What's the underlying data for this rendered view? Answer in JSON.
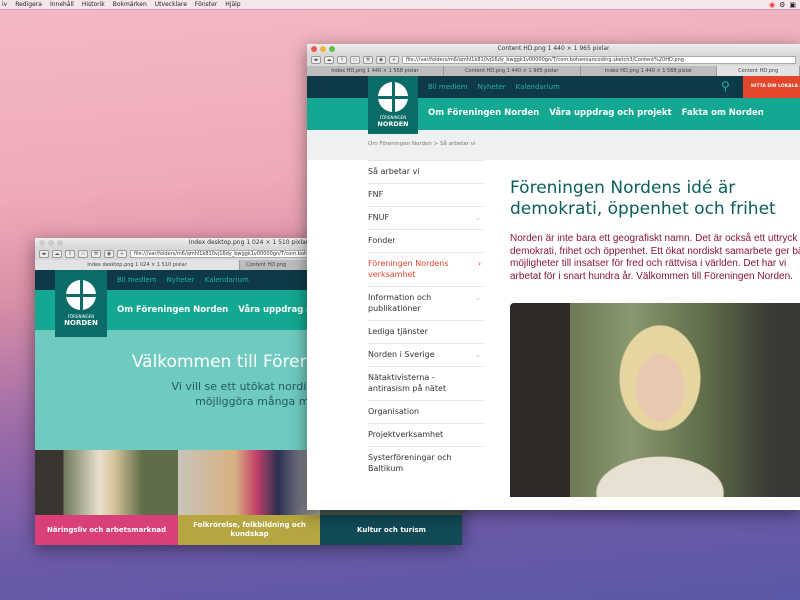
{
  "menubar": {
    "items": [
      "iv",
      "Redigera",
      "Innehåll",
      "Historik",
      "Bokmärken",
      "Utvecklare",
      "Fönster",
      "Hjälp"
    ]
  },
  "back_window": {
    "title": "Index desktop.png 1 024 × 1 510 pixlar",
    "url": "file:///var/folders/m6/qmhl1k810vj16dy_bwggk1v00000gn/T/com.bohemiancoding.sketch3/Index%20desktop.png",
    "tabs": [
      "Index desktop.png 1 024 × 1 510 pixlar",
      "Content HD.png"
    ],
    "logo": {
      "line1": "FÖRENINGEN",
      "line2": "NORDEN"
    },
    "top_links": [
      "Bli medlem",
      "Nyheter",
      "Kalendarium"
    ],
    "nav": [
      "Om Föreningen Norden",
      "Våra uppdrag och projekt"
    ],
    "hero": {
      "title": "Välkommen till Föreningen Norden",
      "subtitle_line1": "Vi vill se ett utökat nordiskt samarbete",
      "subtitle_line2": "möjliggöra många människors"
    },
    "cards": [
      {
        "label": "Näringsliv och arbetsmarknad",
        "color": "#d9407a"
      },
      {
        "label": "Folkrörelse, folkbildning och kundskap",
        "color": "#b5a642"
      },
      {
        "label": "Kultur och turism",
        "color": "#124a55"
      }
    ]
  },
  "front_window": {
    "title": "Content HD.png 1 440 × 1 965 pixlar",
    "url": "file:///var/folders/m6/qmhl1k810vj16dy_bwggk1v00000gn/T/com.bohemiancoding.sketch3/Content%20HD.png",
    "tabs": [
      "Index HD.png 1 440 × 1 568 pixlar",
      "Content HD.png 1 440 × 1 965 pixlar",
      "Index HD.png 1 440 × 1 568 pixlar",
      "Content HD.png"
    ],
    "logo": {
      "line1": "FÖRENINGEN",
      "line2": "NORDEN"
    },
    "top_links": [
      "Bli medlem",
      "Nyheter",
      "Kalendarium"
    ],
    "cta": "HITTA DIN LOKALA FÖRENING",
    "nav": [
      "Om Föreningen Norden",
      "Våra uppdrag och projekt",
      "Fakta om Norden"
    ],
    "breadcrumb": "Om Föreningen Norden > Så arbetar vi",
    "sidebar": [
      {
        "label": "Så arbetar vi"
      },
      {
        "label": "FNF"
      },
      {
        "label": "FNUF",
        "chevron": "down"
      },
      {
        "label": "Fonder"
      },
      {
        "label": "Föreningen Nordens verksamhet",
        "chevron": "right",
        "active": true
      },
      {
        "label": "Information och publikationer",
        "chevron": "down"
      },
      {
        "label": "Lediga tjänster"
      },
      {
        "label": "Norden i Sverige",
        "chevron": "down"
      },
      {
        "label": "Nätaktivisterna - antirasism på nätet"
      },
      {
        "label": "Organisation"
      },
      {
        "label": "Projektverksamhet"
      },
      {
        "label": "Systerföreningar och Baltikum"
      }
    ],
    "heading": "Föreningen Nordens idé är demokrati, öppenhet och frihet",
    "intro": "Norden är inte bara ett geografiskt namn. Det är också ett uttryck för demokrati, frihet och öppenhet. Ett ökat nordiskt samarbete ger bättre möjligheter till insatser för fred och rättvisa i världen. Det har vi arbetat för i snart hundra år. Välkommen till Föreningen Norden."
  },
  "colors": {
    "dark": "#0e3a47",
    "teal": "#13a891",
    "logo": "#0b6b66",
    "hero": "#6fcbbf",
    "cta": "#e2472c",
    "heading": "#0b5e5a",
    "intro": "#8a1538"
  }
}
